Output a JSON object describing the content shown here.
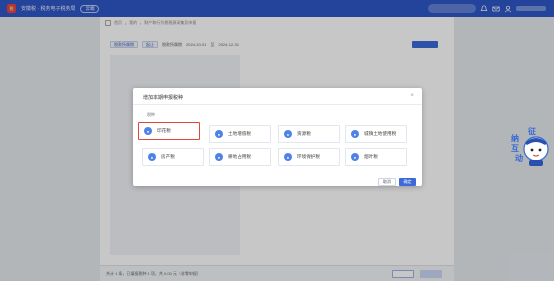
{
  "header": {
    "logo_glyph": "税",
    "app_title": "安徽税 · 税务电子税务局",
    "region_pill": "云端",
    "icons": [
      "bell-icon",
      "mail-icon",
      "user-icon"
    ]
  },
  "breadcrumb": {
    "home_label": "首页",
    "items": [
      "我的",
      "财产和行为税税源采集及申报"
    ]
  },
  "form_strip": {
    "btn1": "税款所属期",
    "btn2": "起止",
    "label": "税款所属期",
    "start_date": "2024-10-01",
    "sep": "至",
    "end_date": "2024-12-31"
  },
  "bottom_bar": {
    "text": "共计 1 条，已填报税种 1 项，共 0.00 元（非零申报）"
  },
  "modal": {
    "title": "增加本期申报税种",
    "close_glyph": "×",
    "section_label": "税种",
    "taxes": [
      {
        "label": "印花税",
        "icon": "stamp-tax-icon"
      },
      {
        "label": "土地增值税",
        "icon": "land-appreciation-tax-icon"
      },
      {
        "label": "资源税",
        "icon": "resource-tax-icon"
      },
      {
        "label": "城镇土地使用税",
        "icon": "urban-land-use-tax-icon"
      },
      {
        "label": "房产税",
        "icon": "property-tax-icon"
      },
      {
        "label": "耕地占用税",
        "icon": "farmland-occupation-tax-icon"
      },
      {
        "label": "环境保护税",
        "icon": "environmental-protection-tax-icon"
      },
      {
        "label": "烟叶税",
        "icon": "tobacco-leaf-tax-icon"
      }
    ],
    "highlighted_tax": "印花税",
    "cancel_label": "取消",
    "ok_label": "确定"
  },
  "mascot": {
    "chars": [
      "征",
      "纳",
      "互",
      "动"
    ]
  },
  "colors": {
    "brand_blue": "#2f58c8",
    "primary_button": "#3d6ad9",
    "highlight_red": "#e0473b",
    "tax_icon_blue": "#4f82e8"
  }
}
